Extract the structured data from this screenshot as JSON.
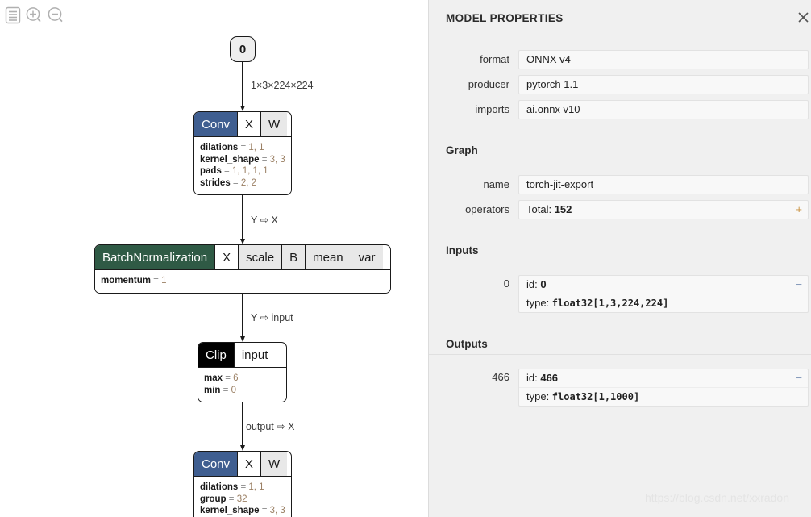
{
  "toolbar": {
    "items": [
      {
        "name": "menu-icon",
        "title": "Menu"
      },
      {
        "name": "zoom-in-icon",
        "title": "Zoom In"
      },
      {
        "name": "zoom-out-icon",
        "title": "Zoom Out"
      }
    ]
  },
  "graph": {
    "input_node": {
      "label": "0"
    },
    "nodes": [
      {
        "type": "Conv",
        "header_color": "#3f5e90",
        "args": [
          {
            "label": "X",
            "primary": true
          },
          {
            "label": "W",
            "primary": false
          }
        ],
        "attributes": [
          {
            "name": "dilations",
            "value": "1, 1"
          },
          {
            "name": "kernel_shape",
            "value": "3, 3"
          },
          {
            "name": "pads",
            "value": "1, 1, 1, 1"
          },
          {
            "name": "strides",
            "value": "2, 2"
          }
        ]
      },
      {
        "type": "BatchNormalization",
        "header_color": "#2f5a45",
        "args": [
          {
            "label": "X",
            "primary": true
          },
          {
            "label": "scale",
            "primary": false
          },
          {
            "label": "B",
            "primary": false
          },
          {
            "label": "mean",
            "primary": false
          },
          {
            "label": "var",
            "primary": false
          }
        ],
        "attributes": [
          {
            "name": "momentum",
            "value": "1"
          }
        ]
      },
      {
        "type": "Clip",
        "header_color": "#000000",
        "args": [
          {
            "label": "input",
            "primary": true
          }
        ],
        "attributes": [
          {
            "name": "max",
            "value": "6"
          },
          {
            "name": "min",
            "value": "0"
          }
        ]
      },
      {
        "type": "Conv",
        "header_color": "#3f5e90",
        "args": [
          {
            "label": "X",
            "primary": true
          },
          {
            "label": "W",
            "primary": false
          }
        ],
        "attributes": [
          {
            "name": "dilations",
            "value": "1, 1"
          },
          {
            "name": "group",
            "value": "32"
          },
          {
            "name": "kernel_shape",
            "value": "3, 3"
          }
        ]
      }
    ],
    "edge_labels": [
      "1×3×224×224",
      "Y ⇨ X",
      "Y ⇨ input",
      "output ⇨ X"
    ]
  },
  "sidebar": {
    "title": "MODEL PROPERTIES",
    "close_label": "×",
    "model": {
      "rows": [
        {
          "label": "format",
          "value": "ONNX v4"
        },
        {
          "label": "producer",
          "value": "pytorch 1.1"
        },
        {
          "label": "imports",
          "value": "ai.onnx v10"
        }
      ]
    },
    "graph_section": {
      "title": "Graph",
      "rows": [
        {
          "label": "name",
          "value": "torch-jit-export",
          "expander": ""
        },
        {
          "label": "operators",
          "value_prefix": "Total: ",
          "value_bold": "152",
          "expander": "+"
        }
      ]
    },
    "inputs_section": {
      "title": "Inputs",
      "items": [
        {
          "label": "0",
          "id_prefix": "id: ",
          "id_value": "0",
          "type_prefix": "type: ",
          "type_value": "float32[1,3,224,224]",
          "expander": "−"
        }
      ]
    },
    "outputs_section": {
      "title": "Outputs",
      "items": [
        {
          "label": "466",
          "id_prefix": "id: ",
          "id_value": "466",
          "type_prefix": "type: ",
          "type_value": "float32[1,1000]",
          "expander": "−"
        }
      ]
    }
  },
  "watermark": {
    "text": "https://blog.csdn.net/xxradon"
  }
}
